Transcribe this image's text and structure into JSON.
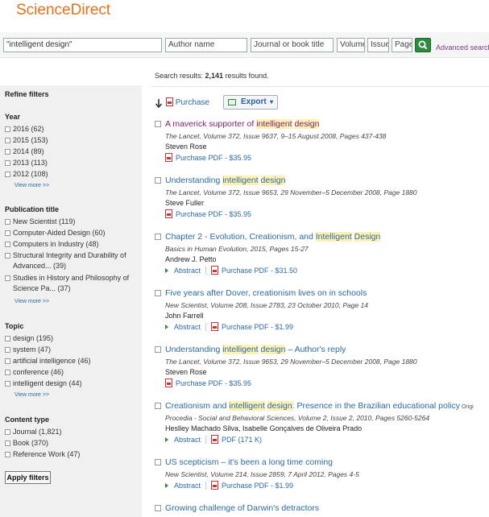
{
  "brand": "ScienceDirect",
  "search": {
    "query": "\"intelligent design\"",
    "author_placeholder": "Author name",
    "journal_placeholder": "Journal or book title",
    "volume_placeholder": "Volume",
    "issue_placeholder": "Issue",
    "page_placeholder": "Page",
    "advanced_link": "Advanced search"
  },
  "results_summary": {
    "prefix": "Search results: ",
    "count": "2,141",
    "suffix": " results found."
  },
  "sidebar": {
    "title": "Refine filters",
    "sections": [
      {
        "heading": "Year",
        "items": [
          "2016  (62)",
          "2015  (153)",
          "2014  (89)",
          "2013  (113)",
          "2012  (108)"
        ],
        "view_more": "View more >>"
      },
      {
        "heading": "Publication title",
        "items": [
          "New Scientist  (119)",
          "Computer-Aided Design  (60)",
          "Computers in Industry  (48)",
          "Structural Integrity and Durability of Advanced...  (39)",
          "Studies in History and Philosophy of Science Pa...  (37)"
        ],
        "view_more": "View more >>"
      },
      {
        "heading": "Topic",
        "items": [
          "design  (195)",
          "system  (47)",
          "artificial intelligence  (46)",
          "conference  (46)",
          "intelligent design  (44)"
        ],
        "view_more": "View more >>"
      },
      {
        "heading": "Content type",
        "items": [
          "Journal  (1,821)",
          "Book  (370)",
          "Reference Work  (47)"
        ]
      }
    ],
    "apply_button": "Apply filters"
  },
  "toolbar": {
    "purchase": "Purchase",
    "export": "Export"
  },
  "results": [
    {
      "title_parts": [
        "A maverick supporter of ",
        "intelligent",
        " ",
        "design",
        ""
      ],
      "visited": true,
      "source": "The Lancet, Volume 372, Issue 9637, 9–15 August 2008, Pages 437-438",
      "authors": "Steven Rose",
      "links": [
        "Purchase PDF - $35.95"
      ]
    },
    {
      "title_parts": [
        "Understanding ",
        "intelligent",
        " ",
        "design",
        ""
      ],
      "visited": false,
      "source": "The Lancet, Volume 372, Issue 9653, 29 November–5 December 2008, Page 1880",
      "authors": "Steve Fuller",
      "links": [
        "Purchase PDF - $35.95"
      ]
    },
    {
      "title_parts": [
        "Chapter 2 - Evolution, Creationism, and ",
        "Intelligent",
        " ",
        "Design",
        ""
      ],
      "visited": false,
      "source": "Basics in Human Evolution, 2015, Pages 15-27",
      "authors": "Andrew J. Petto",
      "links": [
        "Abstract",
        "Purchase PDF - $31.50"
      ]
    },
    {
      "title_parts": [
        "Five years after Dover, creationism lives on in schools"
      ],
      "visited": false,
      "source": "New Scientist, Volume 208, Issue 2783, 23 October 2010, Page 14",
      "authors": "John Farrell",
      "links": [
        "Abstract",
        "Purchase PDF - $1.99"
      ]
    },
    {
      "title_parts": [
        "Understanding ",
        "intelligent",
        " ",
        "design",
        " – Author's reply"
      ],
      "visited": false,
      "source": "The Lancet, Volume 372, Issue 9653, 29 November–5 December 2008, Page 1880",
      "authors": "Steven Rose",
      "links": [
        "Purchase PDF - $35.95"
      ]
    },
    {
      "title_parts": [
        "Creationism and ",
        "intelligent",
        " ",
        "design",
        ": Presence in the Brazilian educational policy"
      ],
      "title_suffix": "Origi",
      "visited": false,
      "source": "Procedia - Social and Behavioral Sciences, Volume 2, Issue 2, 2010, Pages 5260-5264",
      "authors": "Heslley Machado Silva, Isabelle Gonçalves de Oliveira Prado",
      "links": [
        "Abstract",
        "PDF (171 K)"
      ]
    },
    {
      "title_parts": [
        "US scepticism – it's been a long time coming"
      ],
      "visited": false,
      "source": "New Scientist, Volume 214, Issue 2859, 7 April 2012, Pages 4-5",
      "authors": "",
      "links": [
        "Abstract",
        "Purchase PDF - $1.99"
      ]
    },
    {
      "title_parts": [
        "Growing challenge of Darwin's detractors"
      ],
      "visited": false,
      "source": "",
      "authors": "",
      "links": []
    }
  ]
}
